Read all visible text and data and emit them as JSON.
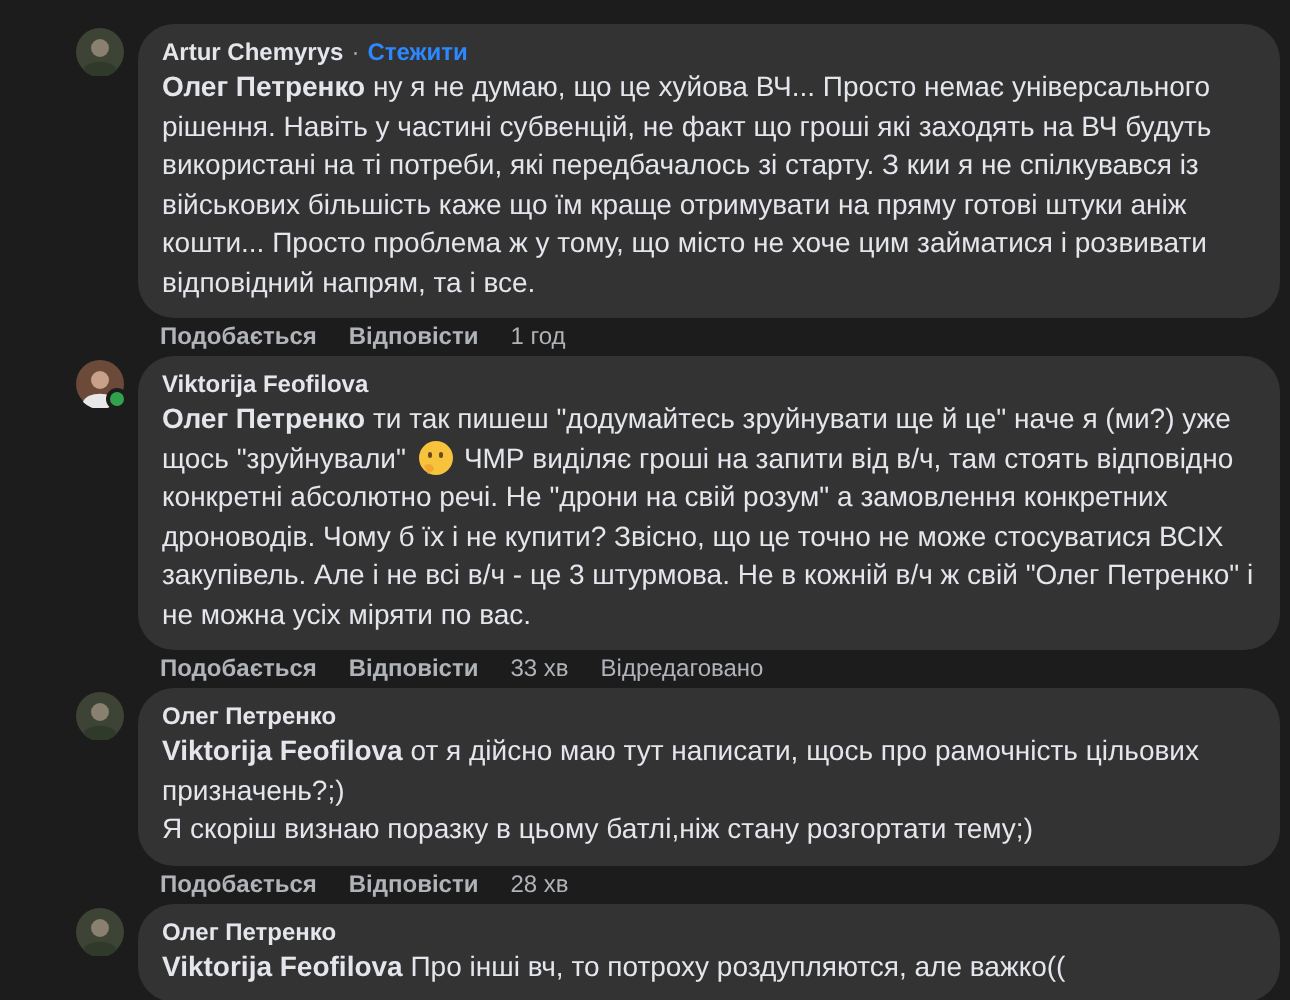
{
  "comments": [
    {
      "author": "Artur Chemyrys",
      "separator": "·",
      "follow": "Стежити",
      "online": false,
      "parts": [
        {
          "kind": "text",
          "text": "**Олег Петренко** ну я не думаю, що це хуйова ВЧ... Просто немає універсального рішення. Навіть у частині субвенцій, не факт що гроші які заходять на ВЧ будуть використані на ті потреби, які передбачалось зі старту. З кии я не спілкувався із військових більшість каже що їм краще отримувати на пряму готові штуки аніж кошти... Просто проблема ж у тому, що місто не хоче цим займатися і розвивати відповідний напрям, та і все."
        }
      ],
      "like": "Подобається",
      "reply": "Відповісти",
      "time": "1 год"
    },
    {
      "author": "Viktorija Feofilova",
      "online": true,
      "parts": [
        {
          "kind": "text",
          "text": "**Олег Петренко** ти так пишеш \"додумайтесь зруйнувати ще й це\" наче я (ми?) уже"
        },
        {
          "kind": "line",
          "pieces": [
            {
              "kind": "text",
              "text": "щось \"зруйнували\""
            },
            {
              "kind": "emoji"
            },
            {
              "kind": "text",
              "text": "ЧМР виділяє гроші на запити від в/ч, там стоять відповідно"
            }
          ]
        },
        {
          "kind": "text",
          "text": "конкретні абсолютно речі. Не \"дрони на свій розум\" а замовлення конкретних дроноводів. Чому б їх і не купити? Звісно, що це точно не може стосуватися ВСІХ закупівель. Але і не всі в/ч - це 3 штурмова. Не в кожній в/ч ж свій \"Олег Петренко\" і не можна усіх міряти по вас."
        }
      ],
      "like": "Подобається",
      "reply": "Відповісти",
      "time": "33 хв",
      "edited": "Відредаговано"
    },
    {
      "author": "Олег Петренко",
      "online": false,
      "parts": [
        {
          "kind": "text",
          "text": "**Viktorija Feofilova** от я дійсно маю тут написати, щось про рамочність цільових призначень?;)"
        },
        {
          "kind": "text",
          "text": "Я скоріш визнаю поразку в цьому батлі,ніж стану розгортати тему;)"
        }
      ],
      "like": "Подобається",
      "reply": "Відповісти",
      "time": "28 хв"
    },
    {
      "author": "Олег Петренко",
      "online": false,
      "parts": [
        {
          "kind": "text",
          "text": "**Viktorija Feofilova** Про інші вч, то потроху роздупляются, але важко(("
        }
      ]
    }
  ]
}
